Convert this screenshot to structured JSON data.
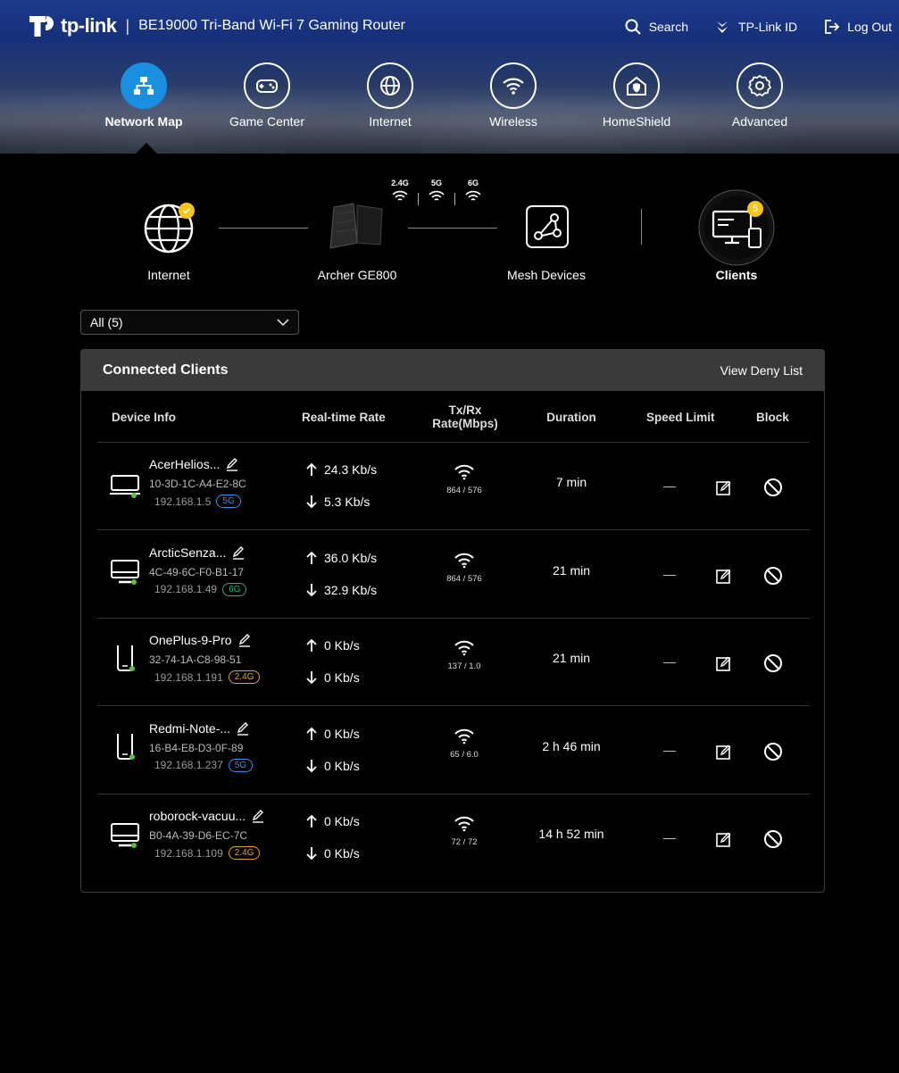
{
  "brand": {
    "logo_text": "tp-link",
    "separator": "|",
    "product": "BE19000 Tri-Band Wi-Fi 7 Gaming Router"
  },
  "top_actions": {
    "search": "Search",
    "tplink_id": "TP-Link ID",
    "logout": "Log Out"
  },
  "nav": [
    {
      "label": "Network Map",
      "icon": "network-map-icon",
      "active": true
    },
    {
      "label": "Game Center",
      "icon": "gamepad-icon",
      "active": false
    },
    {
      "label": "Internet",
      "icon": "globe-icon",
      "active": false
    },
    {
      "label": "Wireless",
      "icon": "wifi-icon",
      "active": false
    },
    {
      "label": "HomeShield",
      "icon": "homeshield-icon",
      "active": false
    },
    {
      "label": "Advanced",
      "icon": "gear-icon",
      "active": false
    }
  ],
  "topology": {
    "internet": "Internet",
    "router": "Archer GE800",
    "mesh": "Mesh Devices",
    "clients": "Clients",
    "clients_count": "5",
    "bands": [
      "2.4G",
      "5G",
      "6G"
    ]
  },
  "filter": {
    "selected": "All (5)"
  },
  "clients_card": {
    "title": "Connected Clients",
    "deny_link": "View Deny List",
    "columns": {
      "device_info": "Device Info",
      "realtime_rate": "Real-time Rate",
      "txrx_line1": "Tx/Rx",
      "txrx_line2": "Rate(Mbps)",
      "duration": "Duration",
      "speed_limit": "Speed Limit",
      "block": "Block"
    },
    "rows": [
      {
        "name": "AcerHelios...",
        "mac": "10-3D-1C-A4-E2-8C",
        "ip": "192.168.1.5",
        "band": "5G",
        "band_class": "b5",
        "device": "laptop",
        "up": "24.3 Kb/s",
        "down": "5.3 Kb/s",
        "txrx": "864 / 576",
        "duration": "7 min",
        "speed_limit": "—"
      },
      {
        "name": "ArcticSenza...",
        "mac": "4C-49-6C-F0-B1-17",
        "ip": "192.168.1.49",
        "band": "6G",
        "band_class": "b6",
        "device": "desktop",
        "up": "36.0 Kb/s",
        "down": "32.9 Kb/s",
        "txrx": "864 / 576",
        "duration": "21 min",
        "speed_limit": "—"
      },
      {
        "name": "OnePlus-9-Pro",
        "mac": "32-74-1A-C8-98-51",
        "ip": "192.168.1.191",
        "band": "2.4G",
        "band_class": "b24",
        "device": "phone",
        "up": "0 Kb/s",
        "down": "0 Kb/s",
        "txrx": "137 / 1.0",
        "duration": "21 min",
        "speed_limit": "—"
      },
      {
        "name": "Redmi-Note-...",
        "mac": "16-B4-E8-D3-0F-89",
        "ip": "192.168.1.237",
        "band": "5G",
        "band_class": "b5",
        "device": "phone",
        "up": "0 Kb/s",
        "down": "0 Kb/s",
        "txrx": "65 / 6.0",
        "duration": "2 h 46 min",
        "speed_limit": "—"
      },
      {
        "name": "roborock-vacuu...",
        "mac": "B0-4A-39-D6-EC-7C",
        "ip": "192.168.1.109",
        "band": "2.4G",
        "band_class": "b24",
        "device": "desktop",
        "up": "0 Kb/s",
        "down": "0 Kb/s",
        "txrx": "72 / 72",
        "duration": "14 h 52 min",
        "speed_limit": "—"
      }
    ]
  },
  "colors": {
    "accent": "#1a8fe0",
    "badge": "#f5c518",
    "online": "#5bc236",
    "band_5g": "#3a8fe8",
    "band_6g": "#31b07a",
    "band_24g": "#e0a236"
  }
}
